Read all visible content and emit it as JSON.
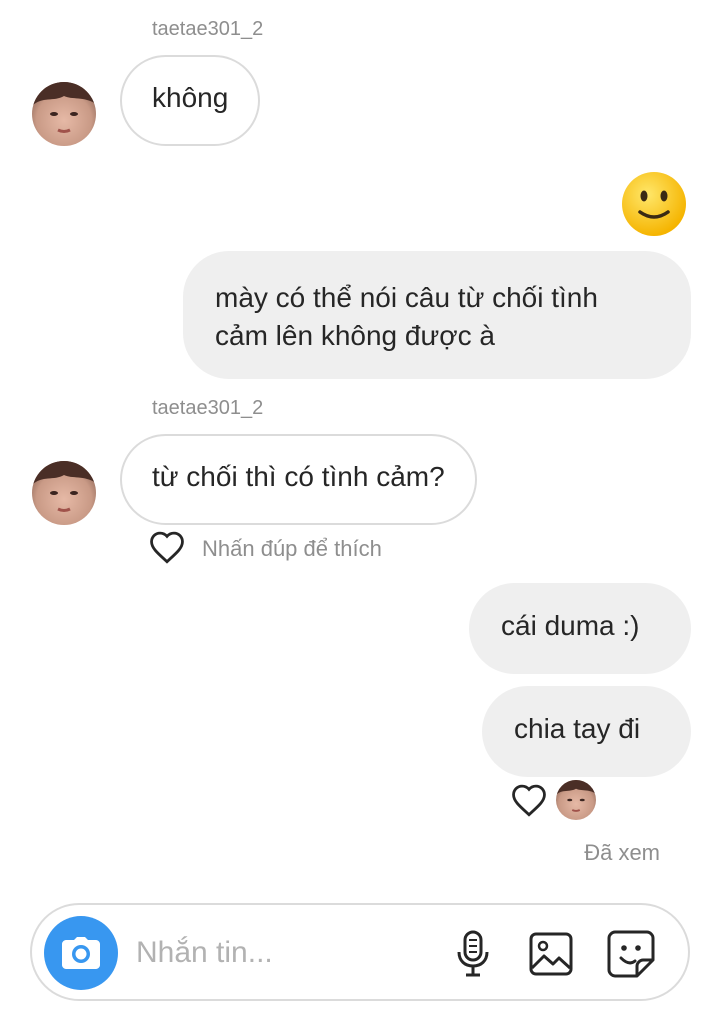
{
  "thread": {
    "messages": [
      {
        "sender_name": "taetae301_2",
        "text": "không"
      },
      {
        "reaction_emoji": "slightly-smiling-face-icon"
      },
      {
        "text_line1": "mày có thể nói câu từ chối tình",
        "text_line2": "cảm lên không được à"
      },
      {
        "sender_name": "taetae301_2",
        "text": "từ chối thì có tình cảm?",
        "like_hint": "Nhấn đúp để thích"
      },
      {
        "text": "cái duma :)"
      },
      {
        "text": "chia tay đi"
      }
    ],
    "seen_label": "Đã xem"
  },
  "composer": {
    "placeholder": "Nhắn tin...",
    "icons": [
      "camera-icon",
      "microphone-icon",
      "gallery-icon",
      "sticker-icon"
    ]
  },
  "colors": {
    "accent_blue": "#3897f0",
    "incoming_border": "#dbdbdb",
    "outgoing_bubble": "#efefef",
    "muted_text": "#8e8e8e"
  }
}
